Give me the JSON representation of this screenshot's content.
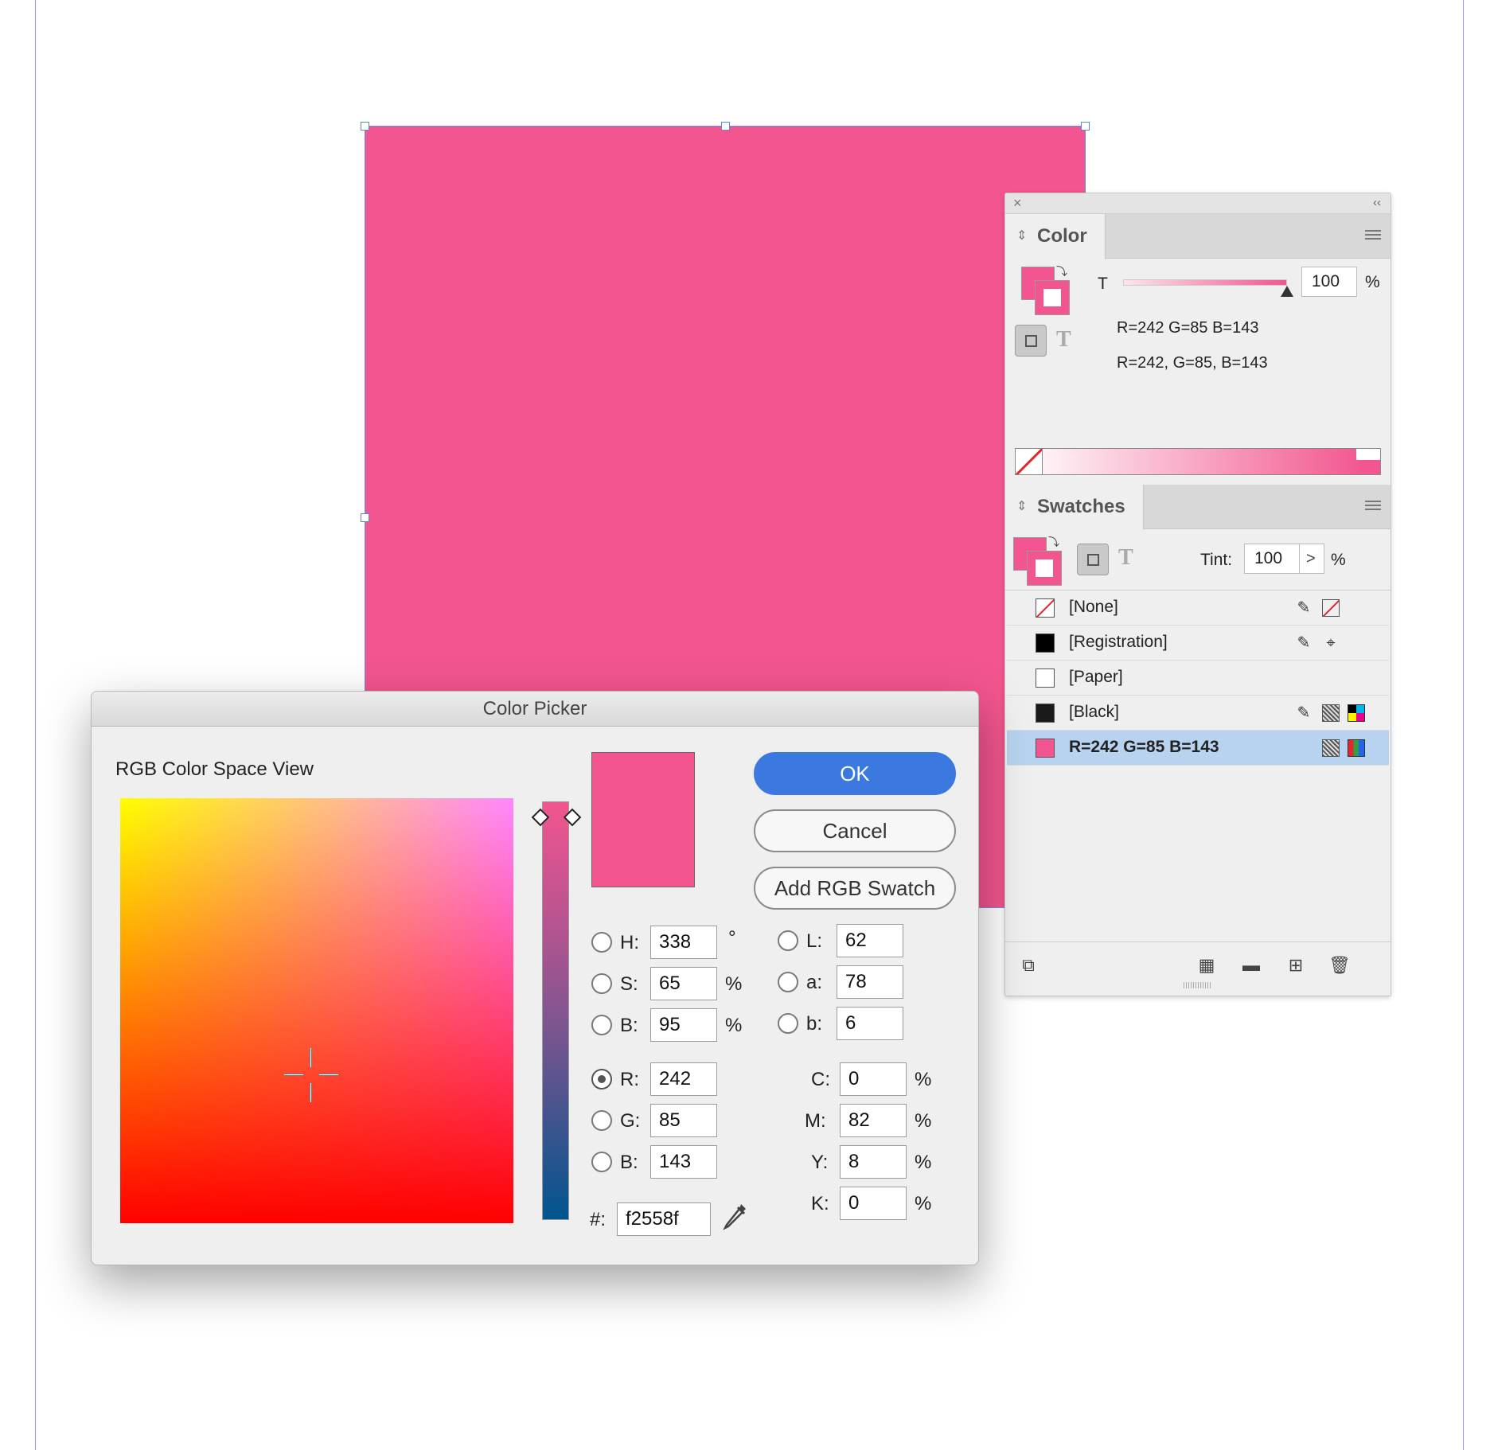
{
  "document": {
    "rect_color": "#f2558f",
    "margin_color": "#a78be6"
  },
  "color_panel": {
    "tab_label": "Color",
    "tint_label": "T",
    "tint_value": "100",
    "tint_unit": "%",
    "tint_level_percent": 100,
    "readout_line1": "R=242 G=85 B=143",
    "readout_line2": "R=242, G=85, B=143",
    "format_text_glyph": "T"
  },
  "swatches_panel": {
    "tab_label": "Swatches",
    "format_text_glyph": "T",
    "tint_label": "Tint:",
    "tint_value": "100",
    "tint_step": ">",
    "tint_unit": "%",
    "items": [
      {
        "name": "[None]",
        "chip": "none",
        "icons": [
          "no-edit-icon",
          "none-swatch-icon"
        ]
      },
      {
        "name": "[Registration]",
        "chip": "#000000",
        "icons": [
          "no-edit-icon",
          "registration-icon"
        ]
      },
      {
        "name": "[Paper]",
        "chip": "#ffffff",
        "icons": []
      },
      {
        "name": "[Black]",
        "chip": "#1a1a1a",
        "icons": [
          "no-edit-icon",
          "process-color-icon",
          "cmyk-mode-icon"
        ]
      },
      {
        "name": "R=242 G=85 B=143",
        "chip": "#f2558f",
        "icons": [
          "process-color-icon",
          "rgb-mode-icon"
        ],
        "selected": true
      }
    ]
  },
  "color_picker": {
    "title": "Color Picker",
    "view_label": "RGB Color Space View",
    "current_color": "#f2558f",
    "buttons": {
      "ok": "OK",
      "cancel": "Cancel",
      "add_swatch": "Add RGB Swatch"
    },
    "hsb": [
      {
        "label": "H:",
        "value": "338",
        "unit": "°"
      },
      {
        "label": "S:",
        "value": "65",
        "unit": "%"
      },
      {
        "label": "B:",
        "value": "95",
        "unit": "%"
      }
    ],
    "lab": [
      {
        "label": "L:",
        "value": "62"
      },
      {
        "label": "a:",
        "value": "78"
      },
      {
        "label": "b:",
        "value": "6"
      }
    ],
    "rgb": [
      {
        "label": "R:",
        "value": "242",
        "selected": true
      },
      {
        "label": "G:",
        "value": "85"
      },
      {
        "label": "B:",
        "value": "143"
      }
    ],
    "cmyk": [
      {
        "label": "C:",
        "value": "0",
        "unit": "%"
      },
      {
        "label": "M:",
        "value": "82",
        "unit": "%"
      },
      {
        "label": "Y:",
        "value": "8",
        "unit": "%"
      },
      {
        "label": "K:",
        "value": "0",
        "unit": "%"
      }
    ],
    "hex_label": "#:",
    "hex_value": "f2558f"
  }
}
